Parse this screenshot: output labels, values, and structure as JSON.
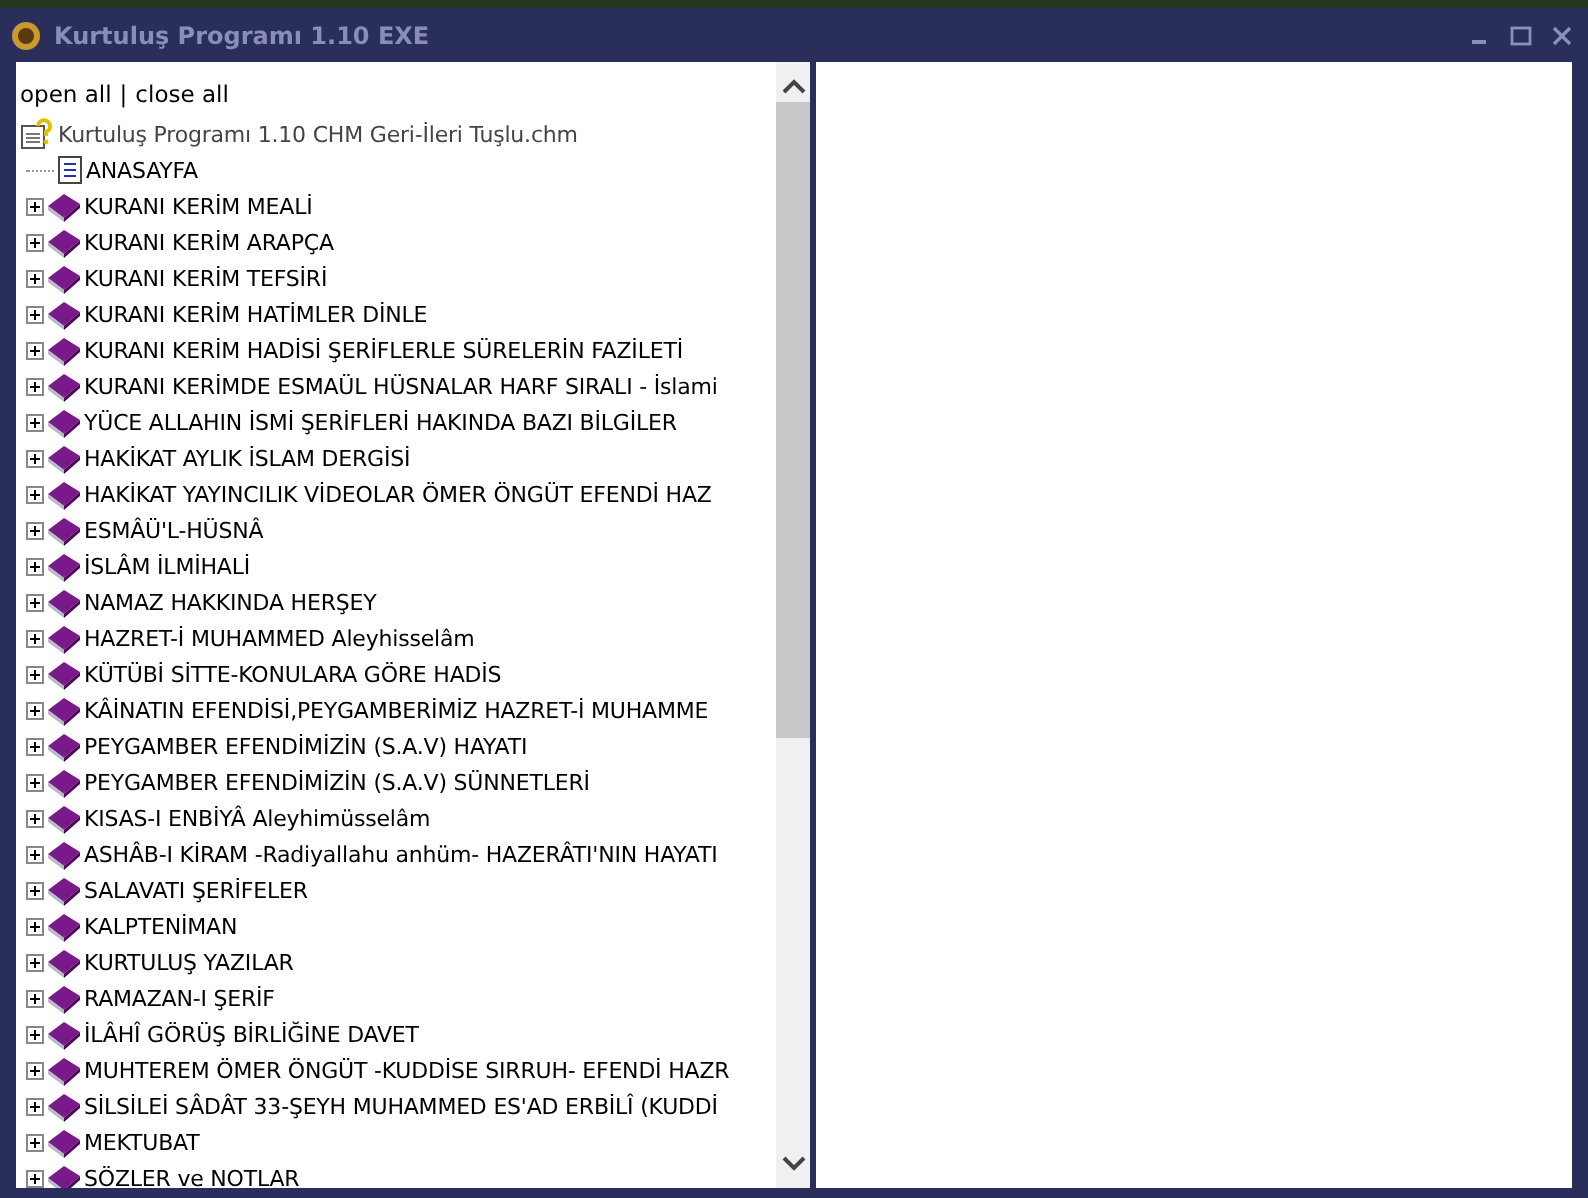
{
  "window": {
    "title": "Kurtuluş Programı 1.10 EXE"
  },
  "toolbar": {
    "open_all": "open all",
    "separator": "|",
    "close_all": "close all"
  },
  "tree": {
    "label": "Kurtuluş Programı 1.10 CHM Geri-İleri Tuşlu.chm",
    "children": [
      {
        "kind": "page",
        "label": "ANASAYFA"
      },
      {
        "kind": "book",
        "label": "KURANI KERİM MEALİ",
        "expanded": false
      },
      {
        "kind": "book",
        "label": "KURANI KERİM ARAPÇA",
        "expanded": false
      },
      {
        "kind": "book",
        "label": "KURANI KERİM TEFSİRİ",
        "expanded": false
      },
      {
        "kind": "book",
        "label": "KURANI KERİM HATİMLER DİNLE",
        "expanded": false
      },
      {
        "kind": "book",
        "label": "KURANI KERİM HADİSİ ŞERİFLERLE SÜRELERİN FAZİLETİ",
        "expanded": false
      },
      {
        "kind": "book",
        "label": "KURANI KERİMDE ESMAÜL HÜSNALAR HARF SIRALI - İslami",
        "expanded": false
      },
      {
        "kind": "book",
        "label": "YÜCE ALLAHIN İSMİ ŞERİFLERİ HAKINDA BAZI BİLGİLER",
        "expanded": false
      },
      {
        "kind": "book",
        "label": "HAKİKAT AYLIK İSLAM DERGİSİ",
        "expanded": false
      },
      {
        "kind": "book",
        "label": "HAKİKAT YAYINCILIK VİDEOLAR ÖMER ÖNGÜT EFENDİ HAZ",
        "expanded": false
      },
      {
        "kind": "book",
        "label": "ESMÂÜ'L-HÜSNÂ",
        "expanded": false
      },
      {
        "kind": "book",
        "label": "İSLÂM İLMİHALİ",
        "expanded": false
      },
      {
        "kind": "book",
        "label": "NAMAZ HAKKINDA HERŞEY",
        "expanded": false
      },
      {
        "kind": "book",
        "label": "HAZRET-İ MUHAMMED Aleyhisselâm",
        "expanded": false
      },
      {
        "kind": "book",
        "label": "KÜTÜBİ SİTTE-KONULARA GÖRE HADİS",
        "expanded": false
      },
      {
        "kind": "book",
        "label": "KÂİNATIN EFENDİSİ,PEYGAMBERİMİZ HAZRET-İ MUHAMME",
        "expanded": false
      },
      {
        "kind": "book",
        "label": "PEYGAMBER EFENDİMİZİN (S.A.V) HAYATI",
        "expanded": false
      },
      {
        "kind": "book",
        "label": "PEYGAMBER EFENDİMİZİN (S.A.V) SÜNNETLERİ",
        "expanded": false
      },
      {
        "kind": "book",
        "label": "KISAS-I ENBİYÂ Aleyhimüsselâm",
        "expanded": false
      },
      {
        "kind": "book",
        "label": "ASHÂB-I KİRAM -Radiyallahu anhüm- HAZERÂTI'NIN HAYATI",
        "expanded": false
      },
      {
        "kind": "book",
        "label": "SALAVATI ŞERİFELER",
        "expanded": false
      },
      {
        "kind": "book",
        "label": "KALPTENİMAN",
        "expanded": false
      },
      {
        "kind": "book",
        "label": "KURTULUŞ YAZILAR",
        "expanded": false
      },
      {
        "kind": "book",
        "label": "RAMAZAN-I ŞERİF",
        "expanded": false
      },
      {
        "kind": "book",
        "label": "İLÂHÎ GÖRÜŞ BİRLİĞİNE DAVET",
        "expanded": false
      },
      {
        "kind": "book",
        "label": "MUHTEREM ÖMER ÖNGÜT -KUDDİSE SIRRUH- EFENDİ HAZR",
        "expanded": false
      },
      {
        "kind": "book",
        "label": "SİLSİLEİ SÂDÂT 33-ŞEYH MUHAMMED ES'AD ERBİLÎ (KUDDİ",
        "expanded": false
      },
      {
        "kind": "book",
        "label": "MEKTUBAT",
        "expanded": false
      },
      {
        "kind": "book",
        "label": "SÖZLER ve NOTLAR",
        "expanded": false
      }
    ]
  }
}
